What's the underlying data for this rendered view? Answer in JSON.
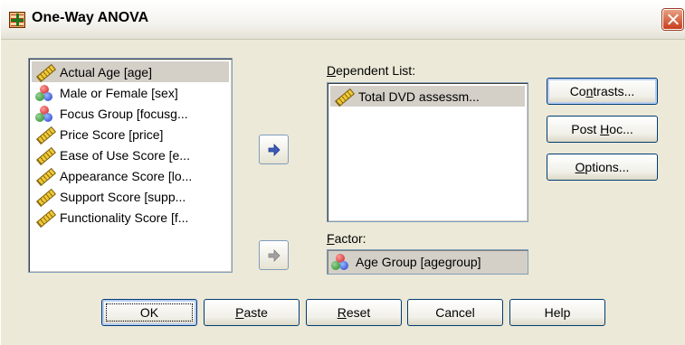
{
  "window": {
    "title": "One-Way ANOVA"
  },
  "variables": [
    {
      "label": "Actual Age [age]",
      "icon": "scale-ruler-icon",
      "selected": true
    },
    {
      "label": "Male or Female [sex]",
      "icon": "nominal-icon",
      "selected": false
    },
    {
      "label": "Focus Group [focusg...",
      "icon": "nominal-icon",
      "selected": false
    },
    {
      "label": "Price Score [price]",
      "icon": "scale-ruler-icon",
      "selected": false
    },
    {
      "label": "Ease of Use Score [e...",
      "icon": "scale-ruler-icon",
      "selected": false
    },
    {
      "label": "Appearance Score [lo...",
      "icon": "scale-ruler-icon",
      "selected": false
    },
    {
      "label": "Support Score [supp...",
      "icon": "scale-ruler-icon",
      "selected": false
    },
    {
      "label": "Functionality Score [f...",
      "icon": "scale-ruler-icon",
      "selected": false
    }
  ],
  "dependent": {
    "label_mnemonic": "D",
    "label_rest": "ependent List:",
    "items": [
      {
        "label": "Total DVD assessm...",
        "icon": "scale-ruler-icon"
      }
    ]
  },
  "factor": {
    "label_mnemonic": "F",
    "label_rest": "actor:",
    "value": "Age Group [agegroup]",
    "icon": "nominal-icon"
  },
  "side_buttons": {
    "contrasts": {
      "pre": "Co",
      "mn": "n",
      "post": "trasts..."
    },
    "posthoc": {
      "pre": "Post ",
      "mn": "H",
      "post": "oc..."
    },
    "options": {
      "pre": "",
      "mn": "O",
      "post": "ptions..."
    }
  },
  "bottom_buttons": {
    "ok": "OK",
    "paste": {
      "mn": "P",
      "post": "aste"
    },
    "reset": {
      "mn": "R",
      "post": "eset"
    },
    "cancel": "Cancel",
    "help": "Help"
  },
  "colors": {
    "dialog_bg": "#ece9d8",
    "button_border": "#003c74",
    "selection_bg": "#d4d0c8",
    "close_red": "#c83c1c"
  }
}
